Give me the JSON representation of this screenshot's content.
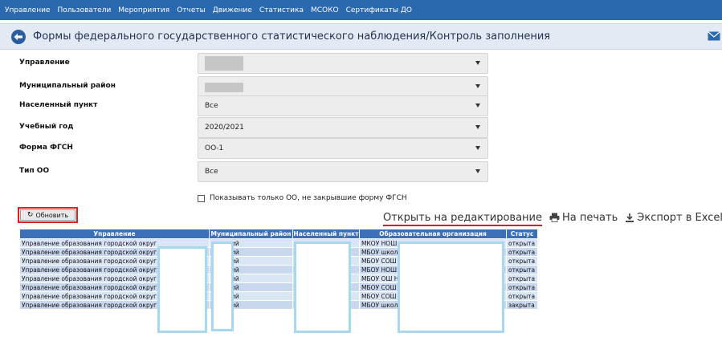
{
  "top_menu": [
    "Управление",
    "Пользователи",
    "Мероприятия",
    "Отчеты",
    "Движение",
    "Статистика",
    "МСОКО",
    "Сертификаты ДО"
  ],
  "header": {
    "title": "Формы федерального государственного статистического наблюдения/Контроль заполнения"
  },
  "filters": {
    "management": {
      "label": "Управление"
    },
    "district": {
      "label": "Муниципальный район"
    },
    "locality": {
      "label": "Населенный пункт",
      "value": "Все"
    },
    "school_year": {
      "label": "Учебный год",
      "value": "2020/2021"
    },
    "form": {
      "label": "Форма ФГСН",
      "value": "ОО-1"
    },
    "org_type": {
      "label": "Тип ОО",
      "value": "Все"
    }
  },
  "checkbox": {
    "label": "Показывать только ОО, не закрывшие форму ФГСН",
    "checked": false
  },
  "refresh_button": {
    "label": "Обновить"
  },
  "actions": {
    "open_edit": "Открыть на редактирование",
    "print": "На печать",
    "export": "Экспорт в Excel"
  },
  "table": {
    "columns": [
      "Управление",
      "Муниципальный район",
      "Населенный пункт",
      "Образовательная организация",
      "Статус"
    ],
    "rows": [
      {
        "management": "Управление образования городской округ",
        "district": "ий",
        "locality": "",
        "org": "МКОУ НОШ",
        "status": "открыта"
      },
      {
        "management": "Управление образования городской округ",
        "district": "ий",
        "locality": "",
        "org": "МБОУ школ",
        "status": "открыта"
      },
      {
        "management": "Управление образования городской округ",
        "district": "ий",
        "locality": "",
        "org": "МБОУ СОШ",
        "status": "открыта"
      },
      {
        "management": "Управление образования городской округ",
        "district": "ий",
        "locality": "",
        "org": "МБОУ НОШ",
        "status": "открыта"
      },
      {
        "management": "Управление образования городской округ",
        "district": "ий",
        "locality": "",
        "org": "МБОУ ОШ Н",
        "status": "открыта"
      },
      {
        "management": "Управление образования городской округ",
        "district": "ий",
        "locality": "",
        "org": "МБОУ СОШ",
        "status": "открыта"
      },
      {
        "management": "Управление образования городской округ",
        "district": "ий",
        "locality": "",
        "org": "МБОУ СОШ",
        "status": "открыта"
      },
      {
        "management": "Управление образования городской округ",
        "district": "ий",
        "locality": "",
        "org": "МБОУ школ",
        "status": "закрыта"
      }
    ]
  },
  "colors": {
    "nav": "#2a69b0",
    "table_header": "#3d6fb8",
    "highlight": "#e02020",
    "redaction_border": "#a6d8ee"
  },
  "icons": {
    "back": "back-arrow-circle-icon",
    "mail": "envelope-icon",
    "refresh": "refresh-icon",
    "print": "printer-icon",
    "export": "excel-export-icon"
  }
}
